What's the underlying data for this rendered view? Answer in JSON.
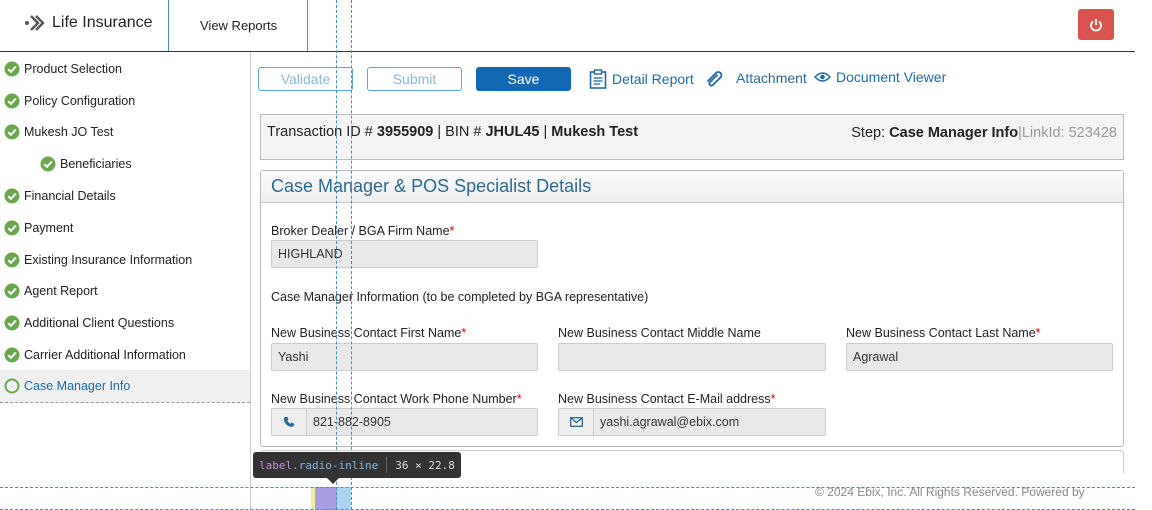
{
  "header": {
    "app_title": "Life Insurance",
    "view_reports": "View Reports",
    "power_icon": "power-icon",
    "power_color": "#d9534f"
  },
  "sidebar": {
    "items": [
      {
        "label": "Product Selection",
        "status": "complete"
      },
      {
        "label": "Policy Configuration",
        "status": "complete"
      },
      {
        "label": "Mukesh JO Test",
        "status": "complete"
      },
      {
        "label": "Beneficiaries",
        "status": "complete",
        "sub": true
      },
      {
        "label": "Financial Details",
        "status": "complete"
      },
      {
        "label": "Payment",
        "status": "complete"
      },
      {
        "label": "Existing Insurance Information",
        "status": "complete"
      },
      {
        "label": "Agent Report",
        "status": "complete"
      },
      {
        "label": "Additional Client Questions",
        "status": "complete"
      },
      {
        "label": "Carrier Additional Information",
        "status": "complete"
      },
      {
        "label": "Case Manager Info",
        "status": "in-progress",
        "active": true
      }
    ],
    "check_color": "#6aa84f"
  },
  "toolbar": {
    "validate_label": "Validate",
    "submit_label": "Submit",
    "save_label": "Save",
    "detail_report_label": "Detail Report",
    "attachment_label": "Attachment",
    "document_viewer_label": "Document Viewer",
    "accent": "#1268b3"
  },
  "transaction": {
    "prefix": "Transaction ID #",
    "id": "3955909",
    "bin_prefix": "| BIN #",
    "bin": "JHUL45",
    "sep": "|",
    "name": "Mukesh Test",
    "step_prefix": "Step:",
    "step": "Case Manager Info",
    "link_prefix": "|LinkId:",
    "link_id": "523428"
  },
  "panel": {
    "title": "Case Manager & POS Specialist Details",
    "broker_label": "Broker Dealer / BGA Firm Name",
    "broker_value": "HIGHLAND",
    "section_note": "Case Manager Information (to be completed by BGA representative)",
    "first_name_label": "New Business Contact First Name",
    "first_name_value": "Yashi",
    "middle_name_label": "New Business Contact Middle Name",
    "middle_name_value": "",
    "last_name_label": "New Business Contact Last Name",
    "last_name_value": "Agrawal",
    "phone_label": "New Business Contact Work Phone Number",
    "phone_value": "821-882-8905",
    "email_label": "New Business Contact E-Mail address",
    "email_value": "yashi.agrawal@ebix.com",
    "required_mark": "*"
  },
  "devtools": {
    "tag": "label",
    "class": ".radio-inline",
    "size": "36 × 22.8"
  },
  "footer": {
    "text": "© 2024 Ebix, Inc. All Rights Reserved. Powered by"
  }
}
